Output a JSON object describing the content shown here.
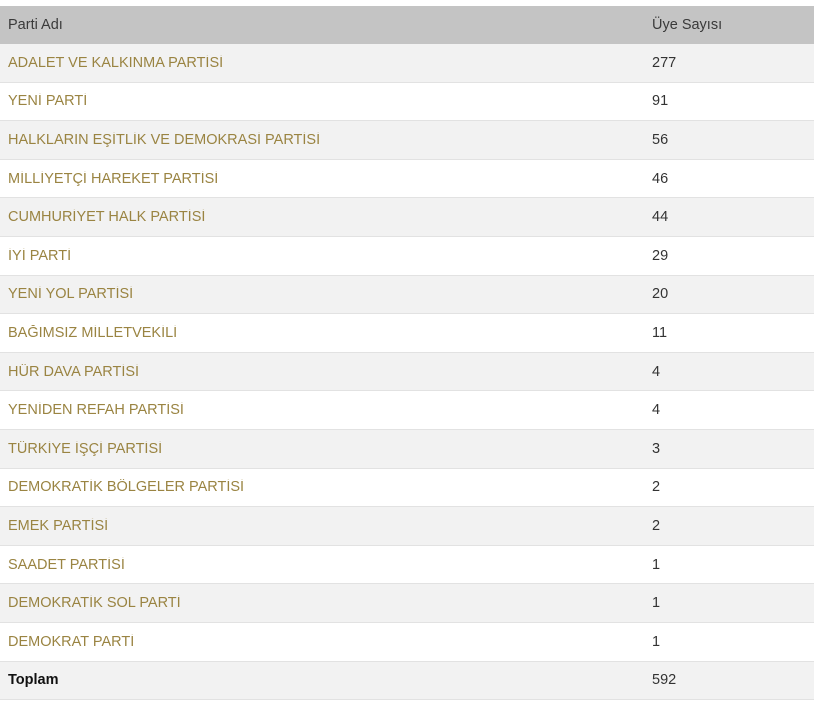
{
  "table": {
    "headers": {
      "name": "Parti Adı",
      "count": "Üye Sayısı"
    },
    "rows": [
      {
        "name": "ADALET VE KALKINMA PARTİSİ",
        "count": "277"
      },
      {
        "name": "YENİ PARTİ",
        "count": "91"
      },
      {
        "name": "HALKLARIN EŞİTLİK VE DEMOKRASİ PARTİSİ",
        "count": "56"
      },
      {
        "name": "MİLLİYETÇİ HAREKET PARTİSİ",
        "count": "46"
      },
      {
        "name": "CUMHURİYET HALK PARTİSİ",
        "count": "44"
      },
      {
        "name": "İYİ PARTİ",
        "count": "29"
      },
      {
        "name": "YENİ YOL PARTİSİ",
        "count": "20"
      },
      {
        "name": "BAĞIMSIZ MİLLETVEKİLİ",
        "count": "11"
      },
      {
        "name": "HÜR DAVA PARTİSİ",
        "count": "4"
      },
      {
        "name": "YENİDEN REFAH PARTİSİ",
        "count": "4"
      },
      {
        "name": "TÜRKİYE İŞÇİ PARTİSİ",
        "count": "3"
      },
      {
        "name": "DEMOKRATİK BÖLGELER PARTİSİ",
        "count": "2"
      },
      {
        "name": "EMEK PARTİSİ",
        "count": "2"
      },
      {
        "name": "SAADET PARTİSİ",
        "count": "1"
      },
      {
        "name": "DEMOKRATİK SOL PARTİ",
        "count": "1"
      },
      {
        "name": "DEMOKRAT PARTİ",
        "count": "1"
      }
    ],
    "total": {
      "name": "Toplam",
      "count": "592"
    }
  },
  "colors": {
    "header_bg": "#c4c4c4",
    "row_stripe": "#f2f2f2",
    "party_link": "#9a8442"
  }
}
